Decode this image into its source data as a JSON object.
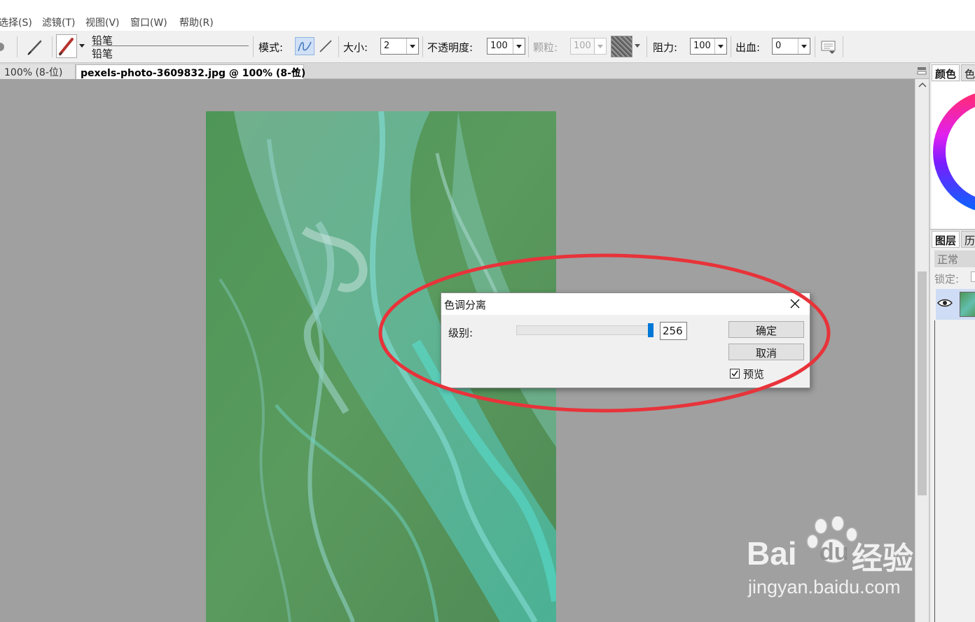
{
  "menu": {
    "items": [
      "选择(S)",
      "滤镜(T)",
      "视图(V)",
      "窗口(W)",
      "帮助(R)"
    ]
  },
  "toolbar": {
    "tool_name_top": "铅笔",
    "tool_name_bottom": "铅笔",
    "mode_label": "模式:",
    "size_label": "大小:",
    "size_value": "2",
    "opacity_label": "不透明度:",
    "opacity_value": "100",
    "grain_label": "颗粒:",
    "grain_value": "100",
    "resist_label": "阻力:",
    "resist_value": "100",
    "bleed_label": "出血:",
    "bleed_value": "0"
  },
  "tabs": [
    {
      "label": "100% (8-位)",
      "active": false
    },
    {
      "label": "pexels-photo-3609832.jpg @ 100% (8-位)",
      "active": true,
      "close": "×"
    }
  ],
  "right_panels": {
    "color_tab": "颜色",
    "color_tab2": "色",
    "layers_tab": "图层",
    "history_tab": "历",
    "blend_mode": "正常",
    "lock_label": "锁定:"
  },
  "dialog": {
    "title": "色调分离",
    "level_label": "级别:",
    "level_value": "256",
    "level_max": 256,
    "ok_label": "确定",
    "cancel_label": "取消",
    "preview_label": "预览",
    "preview_checked": true
  },
  "watermark": {
    "brand": "Bai",
    "brand_suffix": "du",
    "product": "经验",
    "url": "jingyan.baidu.com"
  },
  "colors": {
    "annotation_red": "#e8333a",
    "slider_thumb": "#0078d7",
    "layer_selected": "#cfdcf5"
  }
}
